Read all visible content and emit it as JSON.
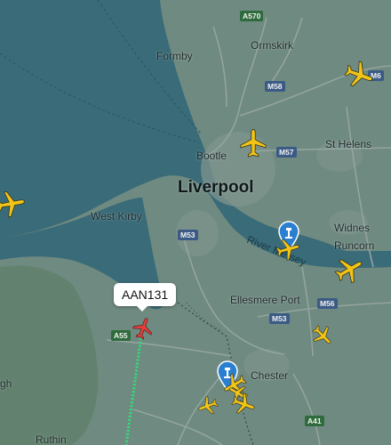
{
  "map": {
    "places": {
      "formby": "Formby",
      "ormskirk": "Ormskirk",
      "bootle": "Bootle",
      "st_helens": "St Helens",
      "liverpool": "Liverpool",
      "west_kirby": "West Kirby",
      "widnes": "Widnes",
      "runcorn": "Runcorn",
      "ellesmere_port": "Ellesmere Port",
      "chester": "Chester",
      "ruthin": "Ruthin",
      "gh_edge": "gh"
    },
    "water": {
      "river_mersey": "River Mersey"
    },
    "roads": {
      "a570": "A570",
      "m58": "M58",
      "m6": "M6",
      "m57": "M57",
      "m53_north": "M53",
      "m53_south": "M53",
      "m56": "M56",
      "a55": "A55",
      "a41": "A41"
    },
    "colors": {
      "sea": "#3a6b78",
      "land": "#6f8a80",
      "urban": "#7f948d",
      "hills": "#5f7f6a",
      "aircraft": "#f2c417",
      "selected_aircraft": "#e0413c",
      "flight_path": "#2ee07a",
      "airport_marker": "#2b7fd1"
    }
  },
  "selected_flight": {
    "callsign": "AAN131"
  },
  "aircraft": [
    {
      "id": "plane-ne-m6",
      "icon": "airplane-icon"
    },
    {
      "id": "plane-west-sea",
      "icon": "airplane-icon"
    },
    {
      "id": "plane-bootle",
      "icon": "airplane-icon"
    },
    {
      "id": "plane-airport-liverpool",
      "icon": "airplane-icon"
    },
    {
      "id": "plane-runcorn",
      "icon": "airplane-icon"
    },
    {
      "id": "plane-m56",
      "icon": "airplane-icon"
    },
    {
      "id": "plane-aan131",
      "icon": "airplane-icon"
    },
    {
      "id": "plane-hawarden-1",
      "icon": "airplane-icon"
    },
    {
      "id": "plane-hawarden-2",
      "icon": "airplane-icon"
    },
    {
      "id": "plane-hawarden-3",
      "icon": "airplane-icon"
    },
    {
      "id": "plane-hawarden-4",
      "icon": "airplane-icon"
    }
  ],
  "airports": [
    {
      "id": "liverpool-airport",
      "icon": "airport-marker-icon"
    },
    {
      "id": "hawarden-airport",
      "icon": "airport-marker-icon"
    }
  ]
}
